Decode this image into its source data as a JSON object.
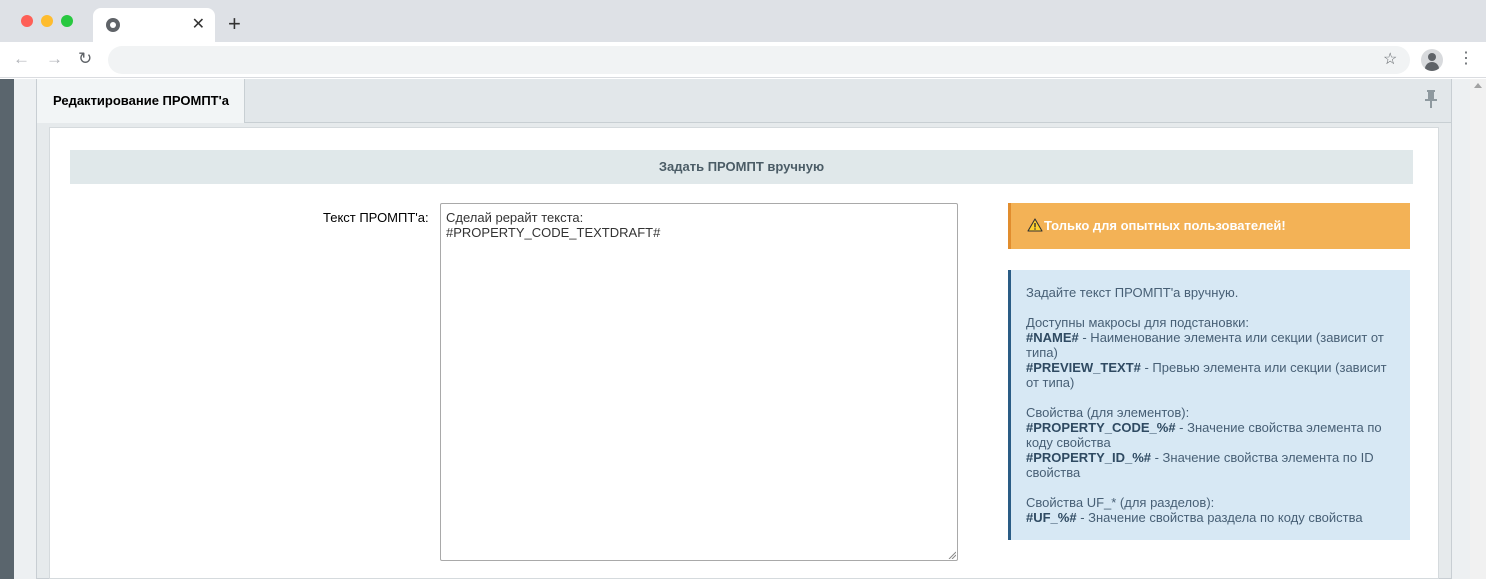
{
  "browser": {
    "tab_close_glyph": "✕",
    "new_tab_glyph": "+",
    "back_glyph": "←",
    "forward_glyph": "→",
    "reload_glyph": "↻",
    "star_glyph": "☆",
    "menu_glyph": "⋮",
    "address": ""
  },
  "admin_tabs": {
    "active": "Редактирование ПРОМПТ'а"
  },
  "section": {
    "title": "Задать ПРОМПТ вручную"
  },
  "form": {
    "prompt_label": "Текст ПРОМПТ'а:",
    "prompt_value": "Сделай рерайт текста:\n#PROPERTY_CODE_TEXTDRAFT#"
  },
  "warning": {
    "text": "Только для опытных пользователей!",
    "icon": "warning-triangle-icon",
    "color": "#f3b256"
  },
  "info": {
    "intro": "Задайте текст ПРОМПТ'а вручную.",
    "macros_heading": "Доступны макросы для подстановки:",
    "macro_name_code": "#NAME#",
    "macro_name_desc": " - Наименование элемента или секции (зависит от типа)",
    "macro_preview_code": "#PREVIEW_TEXT#",
    "macro_preview_desc": " - Превью элемента или секции (зависит от типа)",
    "props_heading": "Свойства (для элементов):",
    "prop_code_code": "#PROPERTY_CODE_%#",
    "prop_code_desc": " - Значение свойства элемента по коду свойства",
    "prop_id_code": "#PROPERTY_ID_%#",
    "prop_id_desc": " - Значение свойства элемента по ID свойства",
    "uf_heading": "Свойства UF_* (для разделов):",
    "uf_code": "#UF_%#",
    "uf_desc": " - Значение свойства раздела по коду свойства",
    "accent_color": "#2a5c85"
  }
}
